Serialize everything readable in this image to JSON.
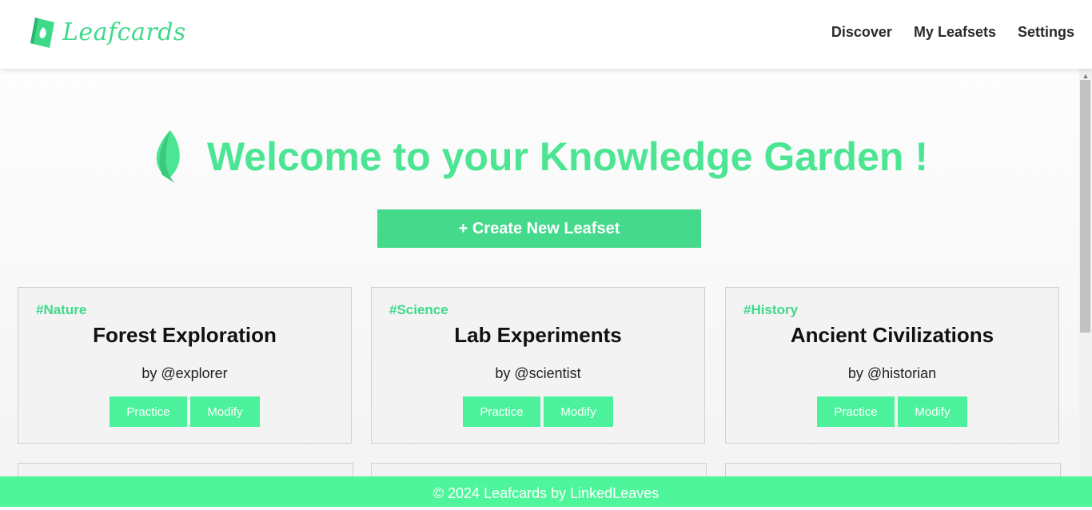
{
  "header": {
    "logo_text": "Leafcards",
    "nav": [
      {
        "label": "Discover"
      },
      {
        "label": "My Leafsets"
      },
      {
        "label": "Settings"
      }
    ]
  },
  "hero": {
    "title": "Welcome to your Knowledge Garden !",
    "create_button": "+ Create New Leafset"
  },
  "cards": [
    {
      "tag": "#Nature",
      "title": "Forest Exploration",
      "author": "by @explorer",
      "practice": "Practice",
      "modify": "Modify"
    },
    {
      "tag": "#Science",
      "title": "Lab Experiments",
      "author": "by @scientist",
      "practice": "Practice",
      "modify": "Modify"
    },
    {
      "tag": "#History",
      "title": "Ancient Civilizations",
      "author": "by @historian",
      "practice": "Practice",
      "modify": "Modify"
    }
  ],
  "footer": {
    "text": "© 2024 Leafcards by LinkedLeaves"
  },
  "colors": {
    "accent": "#4ce593",
    "button": "#45d98b",
    "footer": "#4ef59b"
  },
  "icons": {
    "logo": "leaf-card-icon",
    "hero": "leaf-icon",
    "scroll": "scroll-up-arrow-icon"
  }
}
